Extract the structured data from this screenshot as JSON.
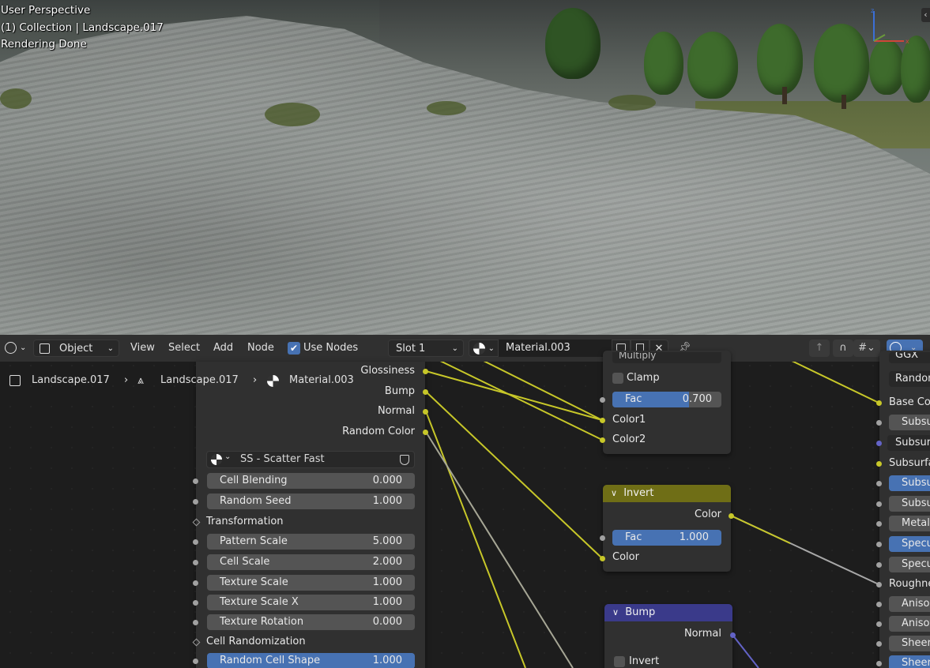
{
  "viewport": {
    "line1": "User Perspective",
    "line2": "(1) Collection | Landscape.017",
    "line3": "Rendering Done",
    "collapse_arrow": "‹"
  },
  "header": {
    "editor_type_icon": "node-editor-icon",
    "mode_label": "Object",
    "menus": [
      "View",
      "Select",
      "Add",
      "Node"
    ],
    "use_nodes_label": "Use Nodes",
    "use_nodes_checked": true,
    "slot_label": "Slot 1",
    "material_name": "Material.003"
  },
  "breadcrumb": {
    "object": "Landscape.017",
    "mesh": "Landscape.017",
    "material": "Material.003",
    "separator": "›"
  },
  "group_node": {
    "outputs": [
      "Glossiness",
      "Bump",
      "Normal",
      "Random Color"
    ],
    "group_name": "SS - Scatter Fast",
    "fields": [
      {
        "label": "Cell Blending",
        "value": "0.000"
      },
      {
        "label": "Random Seed",
        "value": "1.000"
      }
    ],
    "section_transformation": "Transformation",
    "transform_fields": [
      {
        "label": "Pattern Scale",
        "value": "5.000"
      },
      {
        "label": "Cell Scale",
        "value": "2.000"
      },
      {
        "label": "Texture Scale",
        "value": "1.000"
      },
      {
        "label": "Texture Scale X",
        "value": "1.000"
      },
      {
        "label": "Texture Rotation",
        "value": "0.000"
      }
    ],
    "section_randomization": "Cell Randomization",
    "random_cell_shape": {
      "label": "Random Cell Shape",
      "value": "1.000"
    }
  },
  "mix_node": {
    "blend_mode": "Multiply",
    "clamp_label": "Clamp",
    "fac_label": "Fac",
    "fac_value": "0.700",
    "fac_fraction": 0.7,
    "inputs": [
      "Color1",
      "Color2"
    ]
  },
  "invert_node": {
    "title": "Invert",
    "output": "Color",
    "fac_label": "Fac",
    "fac_value": "1.000",
    "input": "Color"
  },
  "bump_node": {
    "title": "Bump",
    "output": "Normal",
    "invert_label": "Invert"
  },
  "bsdf_node": {
    "top_clipped_1": "GGX",
    "top_clipped_2": "Random",
    "inputs": [
      "Base Colo",
      "Subsu",
      "Subsur",
      "Subsurfa",
      "Subsu",
      "Subsu",
      "Metall",
      "Specu",
      "Specu",
      "Roughne",
      "Aniso",
      "Anisot",
      "Sheer",
      "Sheer"
    ]
  },
  "colors": {
    "accent_blue": "#4772b3",
    "socket_yellow": "#c7c729",
    "socket_gray": "#a1a1a1",
    "socket_purple": "#6363c7",
    "invert_header": "#6f6e16",
    "bump_header": "#3a3a8a",
    "background": "#1d1d1d"
  }
}
